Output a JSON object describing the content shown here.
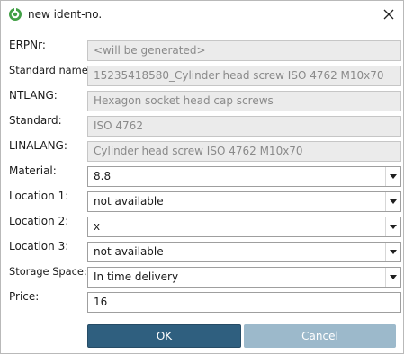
{
  "window": {
    "title": "new ident-no."
  },
  "fields": {
    "erpnr": {
      "label": "ERPNr:",
      "value": "<will be generated>"
    },
    "standard_name": {
      "label": "Standard name:",
      "value": "15235418580_Cylinder head screw ISO 4762 M10x70"
    },
    "ntlang": {
      "label": "NTLANG:",
      "value": "Hexagon socket head cap screws"
    },
    "standard": {
      "label": "Standard:",
      "value": "ISO 4762"
    },
    "linalang": {
      "label": "LINALANG:",
      "value": "Cylinder head screw ISO 4762 M10x70"
    },
    "material": {
      "label": "Material:",
      "value": "8.8"
    },
    "location1": {
      "label": "Location 1:",
      "value": "not available"
    },
    "location2": {
      "label": "Location 2:",
      "value": "x"
    },
    "location3": {
      "label": "Location 3:",
      "value": "not available"
    },
    "storage_space": {
      "label": "Storage Space:",
      "value": "In time delivery"
    },
    "price": {
      "label": "Price:",
      "value": "16"
    }
  },
  "buttons": {
    "ok": "OK",
    "cancel": "Cancel"
  },
  "icons": {
    "app": "app-icon",
    "close": "close-icon",
    "dropdown": "chevron-down-icon"
  },
  "colors": {
    "ok_button": "#2f5f7f",
    "cancel_button": "#9cb9cb",
    "readonly_field": "#ebebeb",
    "app_icon": "#42a046"
  }
}
